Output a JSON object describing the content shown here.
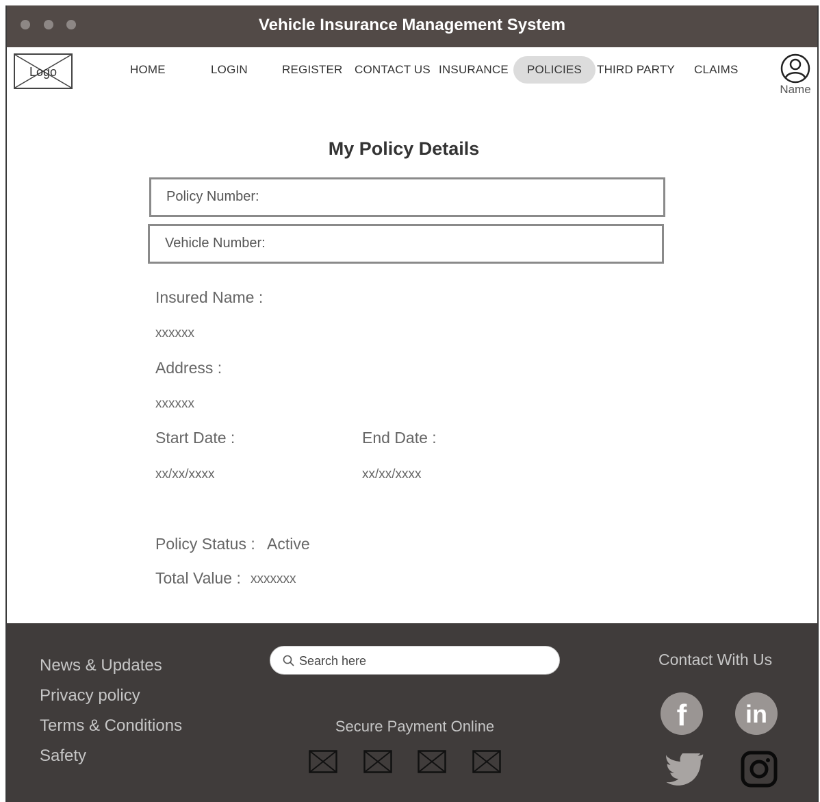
{
  "window": {
    "title": "Vehicle Insurance Management System",
    "controls": [
      "close",
      "minimize",
      "maximize"
    ]
  },
  "header": {
    "logo_label": "Logo",
    "nav": [
      "HOME",
      "LOGIN",
      "REGISTER",
      "CONTACT US",
      "INSURANCE",
      "POLICIES",
      "THIRD PARTY",
      "CLAIMS"
    ],
    "active_nav": "POLICIES",
    "user_icon": "user-circle-icon",
    "user_name": "Name"
  },
  "main": {
    "title": "My Policy Details",
    "policy_number_label": "Policy Number:",
    "vehicle_number_label": "Vehicle Number:",
    "insured_name_label": "Insured Name :",
    "insured_name_value": "xxxxxx",
    "address_label": "Address :",
    "address_value": "xxxxxx",
    "start_date_label": "Start Date :",
    "start_date_value": "xx/xx/xxxx",
    "end_date_label": "End Date :",
    "end_date_value": "xx/xx/xxxx",
    "policy_status_label": "Policy Status :",
    "policy_status_value": "Active",
    "total_value_label": "Total Value :",
    "total_value_value": "xxxxxxx"
  },
  "footer": {
    "links": [
      "News & Updates",
      "Privacy policy",
      "Terms & Conditions",
      "Safety"
    ],
    "search_placeholder": "Search here",
    "secure_payment_title": "Secure Payment Online",
    "payment_icons": [
      "image-placeholder-icon",
      "image-placeholder-icon",
      "image-placeholder-icon",
      "image-placeholder-icon"
    ],
    "contact_title": "Contact With Us",
    "social_icons": [
      "facebook-icon",
      "linkedin-icon",
      "twitter-icon",
      "instagram-icon"
    ],
    "social_letters": {
      "facebook": "f",
      "linkedin": "in"
    }
  },
  "colors": {
    "titlebar": "#524a47",
    "footer": "#403c3b",
    "active_nav_bg": "#dcdcdc",
    "social_icon_bg": "#9a9593"
  }
}
